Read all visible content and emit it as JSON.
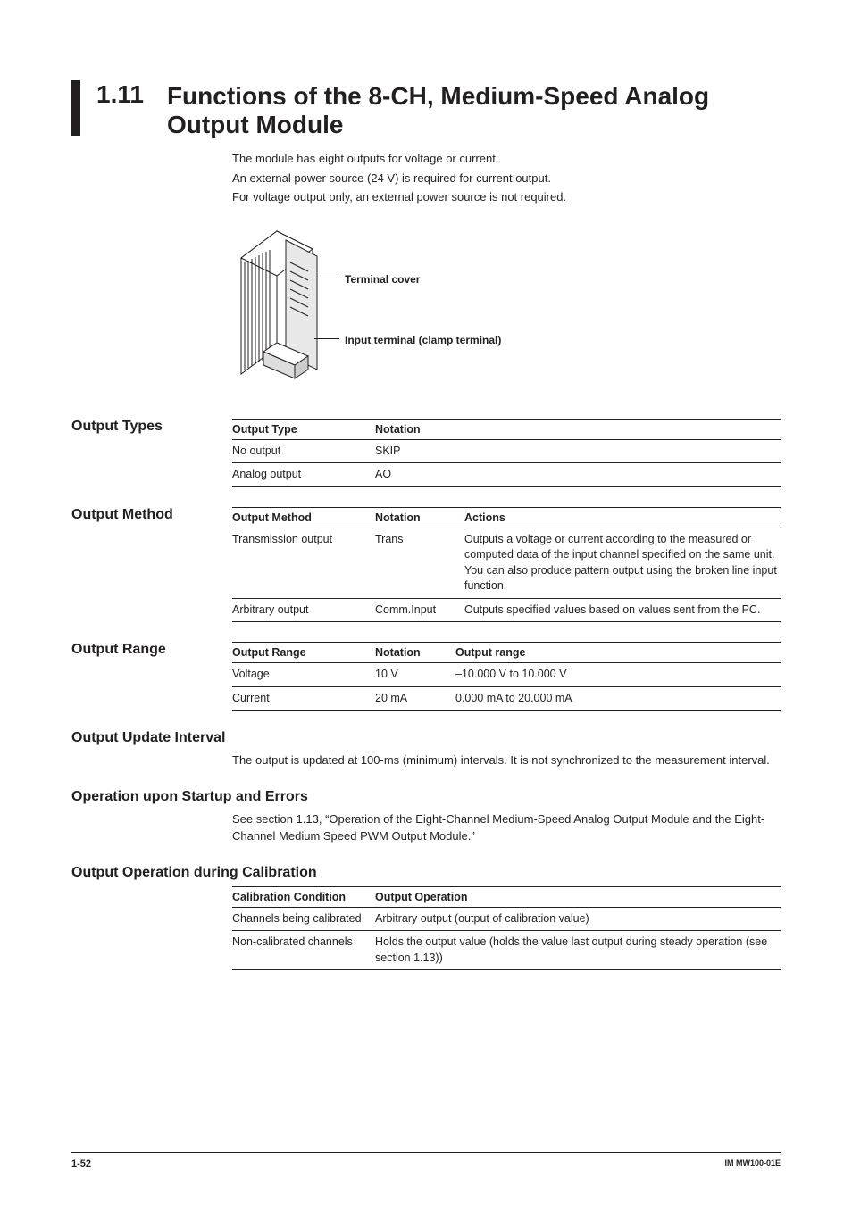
{
  "header": {
    "number": "1.11",
    "title": "Functions of the 8-CH, Medium-Speed Analog Output Module"
  },
  "intro": {
    "l1": "The module has eight outputs for voltage or current.",
    "l2": "An external power source (24 V) is required for current output.",
    "l3": "For voltage output only, an external power source is not required."
  },
  "diagram": {
    "label1": "Terminal cover",
    "label2": "Input terminal (clamp terminal)"
  },
  "output_types": {
    "heading": "Output Types",
    "cols": {
      "c1": "Output Type",
      "c2": "Notation"
    },
    "rows": [
      {
        "type": "No output",
        "notation": "SKIP"
      },
      {
        "type": "Analog output",
        "notation": "AO"
      }
    ]
  },
  "output_method": {
    "heading": "Output Method",
    "cols": {
      "c1": "Output Method",
      "c2": "Notation",
      "c3": "Actions"
    },
    "rows": [
      {
        "method": "Transmission output",
        "notation": "Trans",
        "actions": "Outputs a voltage or current according to the measured or computed data of the input channel specified on the same unit. You can also produce pattern output using the broken line input function."
      },
      {
        "method": "Arbitrary output",
        "notation": "Comm.Input",
        "actions": "Outputs specified values based on values sent from the PC."
      }
    ]
  },
  "output_range": {
    "heading": "Output Range",
    "cols": {
      "c1": "Output Range",
      "c2": "Notation",
      "c3": "Output range"
    },
    "rows": [
      {
        "r": "Voltage",
        "n": "10 V",
        "o": "–10.000 V to 10.000 V"
      },
      {
        "r": "Current",
        "n": "20 mA",
        "o": "0.000 mA to 20.000 mA"
      }
    ]
  },
  "update_interval": {
    "heading": "Output Update Interval",
    "text": "The output is updated at 100-ms (minimum) intervals. It is not synchronized to the measurement interval."
  },
  "startup_errors": {
    "heading": "Operation upon Startup and Errors",
    "text": "See section 1.13, “Operation of the Eight-Channel Medium-Speed Analog Output Module and the Eight-Channel Medium Speed PWM Output Module.”"
  },
  "calibration": {
    "heading": "Output Operation during Calibration",
    "cols": {
      "c1": "Calibration Condition",
      "c2": "Output Operation"
    },
    "rows": [
      {
        "cond": "Channels being calibrated",
        "op": "Arbitrary output (output of calibration value)"
      },
      {
        "cond": "Non-calibrated channels",
        "op": "Holds the output value (holds the value last output during steady operation (see section 1.13))"
      }
    ]
  },
  "footer": {
    "left": "1-52",
    "right": "IM MW100-01E"
  }
}
